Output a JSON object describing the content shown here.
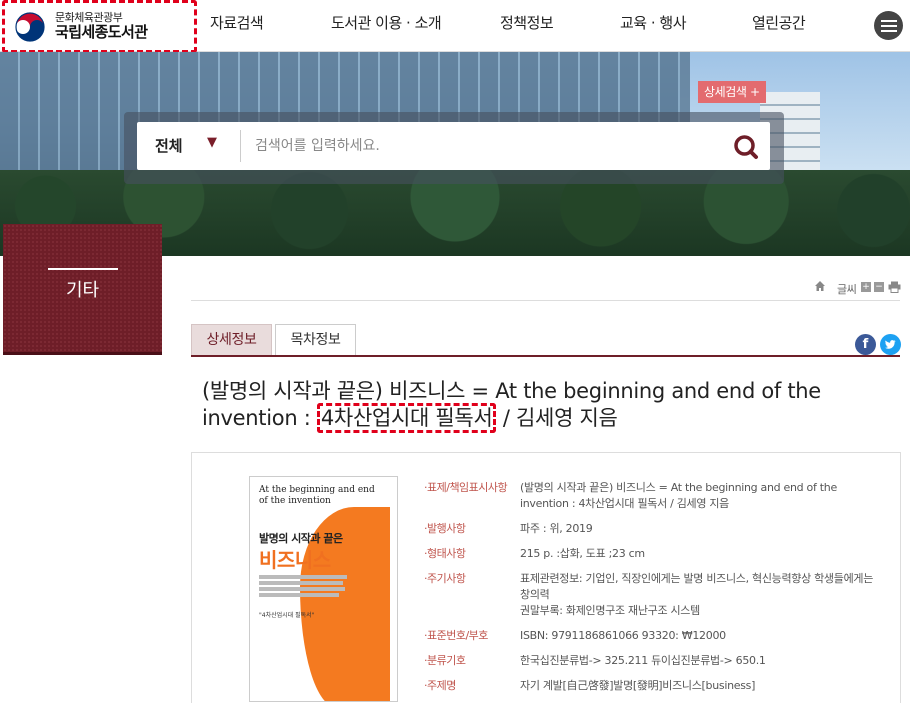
{
  "header": {
    "logo_sub": "문화체육관광부",
    "logo_main": "국립세종도서관",
    "nav": [
      "자료검색",
      "도서관 이용 · 소개",
      "정책정보",
      "교육 · 행사",
      "열린공간"
    ],
    "menu_icon": "hamburger-menu-icon"
  },
  "banner": {
    "advanced_search": "상세검색 +",
    "search_scope": "전체",
    "search_placeholder": "검색어를 입력하세요."
  },
  "sidebar": {
    "title": "기타"
  },
  "tools": {
    "font_label": "글씨",
    "plus": "+",
    "minus": "−"
  },
  "tabs": [
    {
      "label": "상세정보",
      "active": true
    },
    {
      "label": "목차정보",
      "active": false
    }
  ],
  "sns": {
    "facebook": "f",
    "twitter": "t"
  },
  "title": {
    "part1": "(발명의 시작과 끝은) 비즈니스 = At the beginning and end of the invention :",
    "highlight": "4차산업시대 필독서",
    "part2": "/ 김세영 지음"
  },
  "cover": {
    "en": "At the beginning and end of the invention",
    "ko1": "발명의 시작과 끝은",
    "ko2": "비즈니스",
    "series": "\"4차산업시대 필독서\""
  },
  "details": [
    {
      "label": "·표제/책임표시사항",
      "value": "(발명의 시작과 끝은) 비즈니스 = At the beginning and end of the invention : 4차산업시대 필독서 / 김세영 지음"
    },
    {
      "label": "·발행사항",
      "value": "파주 : 위, 2019"
    },
    {
      "label": "·형태사항",
      "value": "215 p. :삽화, 도표 ;23 cm"
    },
    {
      "label": "·주기사항",
      "value": "표제관련정보: 기업인, 직장인에게는 발명 비즈니스, 혁신능력향상 학생들에게는 창의력",
      "value2": "권말부록: 화제인명구조 재난구조 시스템"
    },
    {
      "label": "·표준번호/부호",
      "value": "ISBN: 9791186861066  93320: ₩12000"
    },
    {
      "label": "·분류기호",
      "value": "한국십진분류법-> 325.211  듀이십진분류법-> 650.1"
    },
    {
      "label": "·주제명",
      "value": "자기 계발[自己啓發]발명[發明]비즈니스[business]"
    }
  ]
}
